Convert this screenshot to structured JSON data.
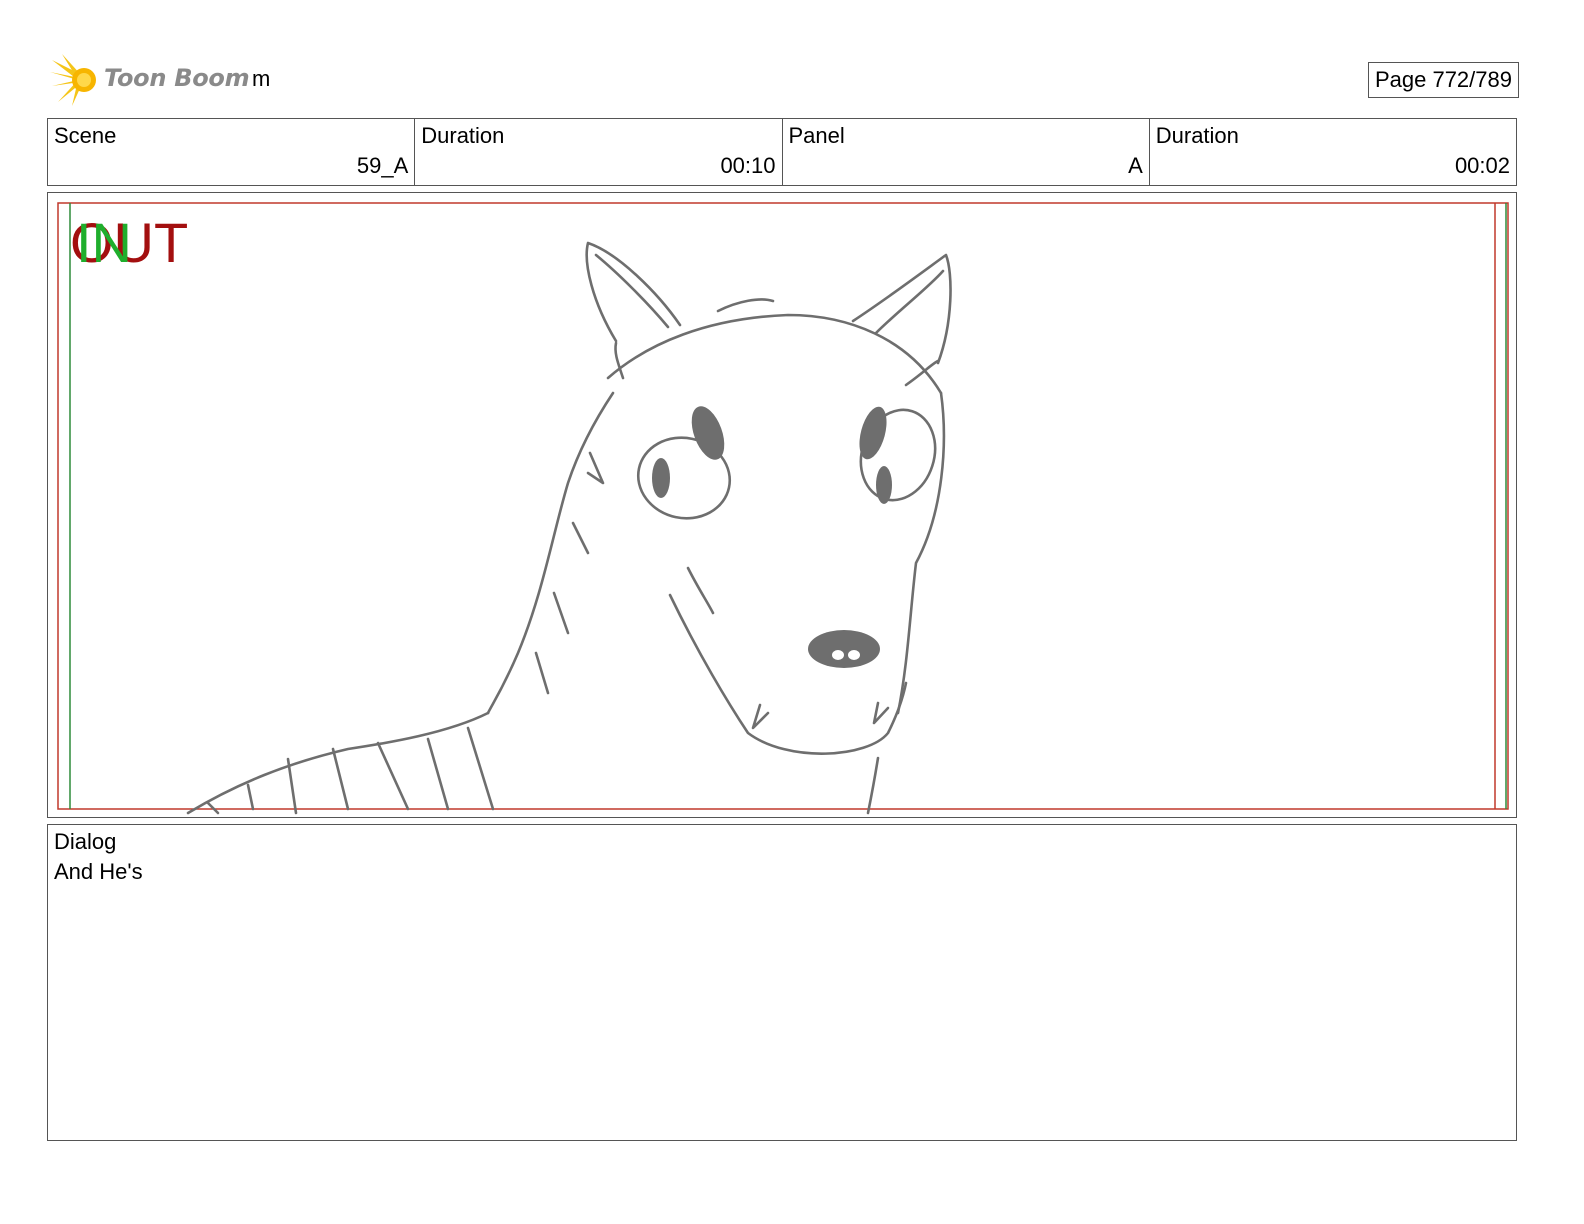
{
  "header": {
    "logo_text": "Toon Boom",
    "project_name": "m",
    "page_label": "Page 772/789"
  },
  "info": {
    "scene_label": "Scene",
    "scene_value": "59_A",
    "scene_duration_label": "Duration",
    "scene_duration_value": "00:10",
    "panel_label": "Panel",
    "panel_value": "A",
    "panel_duration_label": "Duration",
    "panel_duration_value": "00:02"
  },
  "panel": {
    "in_marker": "IN",
    "out_marker": "OUT",
    "in_color": "#1fae2c",
    "out_color": "#a30f0f",
    "safe_frame_color": "#c0392b",
    "action_frame_color": "#2e8b3a",
    "sketch_color": "#6e6e6e",
    "drawing_subject": "wolf-head-sketch"
  },
  "dialog": {
    "label": "Dialog",
    "text": "And He's"
  }
}
